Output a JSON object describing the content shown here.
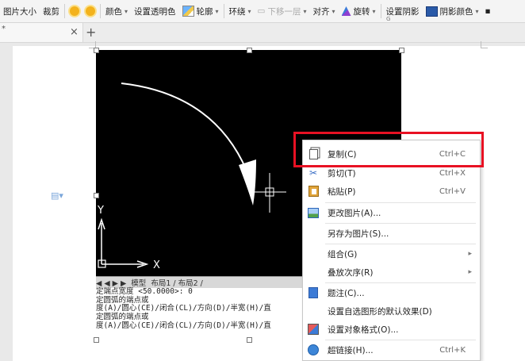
{
  "toolbar": {
    "image_size": "图片大小",
    "crop": "裁剪",
    "color": "颜色",
    "set_transparent": "设置透明色",
    "outline": "轮廓",
    "wrap": "环绕",
    "move_down": "下移一层",
    "align": "对齐",
    "rotate": "旋转",
    "set_shadow": "设置阴影",
    "shadow_color": "阴影颜色",
    "group_marker": "G"
  },
  "tabbar": {
    "close_glyph": "×",
    "add_glyph": "+",
    "star_glyph": "*"
  },
  "cad": {
    "tabs": [
      "◀",
      "◀",
      "▶",
      "▶",
      "模型",
      "布局1",
      "布局2"
    ],
    "axis_y": "Y",
    "axis_x": "X",
    "command_lines": [
      "定端点宽度 <50.0000>: 0",
      "定圆弧的端点或",
      "度(A)/圆心(CE)/闭合(CL)/方向(D)/半宽(H)/直",
      "定圆弧的端点或",
      "度(A)/圆心(CE)/闭合(CL)/方向(D)/半宽(H)/直"
    ]
  },
  "context_menu": {
    "items": [
      {
        "label": "复制(C)",
        "shortcut": "Ctrl+C",
        "icon": "copy-icon"
      },
      {
        "label": "剪切(T)",
        "shortcut": "Ctrl+X",
        "icon": "scissors-icon"
      },
      {
        "label": "粘贴(P)",
        "shortcut": "Ctrl+V",
        "icon": "paste-icon"
      },
      {
        "label": "更改图片(A)...",
        "shortcut": "",
        "icon": "change-picture-icon"
      },
      {
        "label": "另存为图片(S)...",
        "shortcut": "",
        "icon": ""
      },
      {
        "label": "组合(G)",
        "shortcut": "",
        "submenu": true,
        "icon": ""
      },
      {
        "label": "叠放次序(R)",
        "shortcut": "",
        "submenu": true,
        "icon": ""
      },
      {
        "label": "题注(C)...",
        "shortcut": "",
        "icon": "caption-icon"
      },
      {
        "label": "设置自选图形的默认效果(D)",
        "shortcut": "",
        "icon": ""
      },
      {
        "label": "设置对象格式(O)...",
        "shortcut": "",
        "icon": "format-object-icon"
      },
      {
        "label": "超链接(H)...",
        "shortcut": "Ctrl+K",
        "icon": "hyperlink-icon"
      }
    ],
    "submenu_arrow": "▸"
  },
  "colors": {
    "highlight": "#e81123",
    "image_bg": "#000000",
    "curve": "#ffffff"
  }
}
